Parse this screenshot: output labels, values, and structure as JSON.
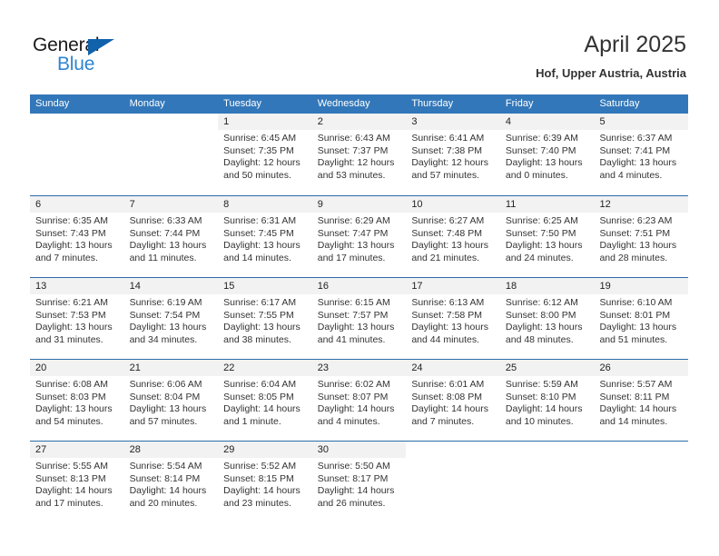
{
  "brand": {
    "name_part1": "General",
    "name_part2": "Blue",
    "triangle_color": "#1062ab",
    "blue_color": "#2e85d0"
  },
  "header": {
    "title": "April 2025",
    "location": "Hof, Upper Austria, Austria"
  },
  "theme": {
    "header_blue": "#3277b9",
    "day_band_gray": "#f2f2f2",
    "text_color": "#333333"
  },
  "weekdays": [
    "Sunday",
    "Monday",
    "Tuesday",
    "Wednesday",
    "Thursday",
    "Friday",
    "Saturday"
  ],
  "weeks": [
    [
      {
        "day": "",
        "sunrise": "",
        "sunset": "",
        "daylight1": "",
        "daylight2": ""
      },
      {
        "day": "",
        "sunrise": "",
        "sunset": "",
        "daylight1": "",
        "daylight2": ""
      },
      {
        "day": "1",
        "sunrise": "Sunrise: 6:45 AM",
        "sunset": "Sunset: 7:35 PM",
        "daylight1": "Daylight: 12 hours",
        "daylight2": "and 50 minutes."
      },
      {
        "day": "2",
        "sunrise": "Sunrise: 6:43 AM",
        "sunset": "Sunset: 7:37 PM",
        "daylight1": "Daylight: 12 hours",
        "daylight2": "and 53 minutes."
      },
      {
        "day": "3",
        "sunrise": "Sunrise: 6:41 AM",
        "sunset": "Sunset: 7:38 PM",
        "daylight1": "Daylight: 12 hours",
        "daylight2": "and 57 minutes."
      },
      {
        "day": "4",
        "sunrise": "Sunrise: 6:39 AM",
        "sunset": "Sunset: 7:40 PM",
        "daylight1": "Daylight: 13 hours",
        "daylight2": "and 0 minutes."
      },
      {
        "day": "5",
        "sunrise": "Sunrise: 6:37 AM",
        "sunset": "Sunset: 7:41 PM",
        "daylight1": "Daylight: 13 hours",
        "daylight2": "and 4 minutes."
      }
    ],
    [
      {
        "day": "6",
        "sunrise": "Sunrise: 6:35 AM",
        "sunset": "Sunset: 7:43 PM",
        "daylight1": "Daylight: 13 hours",
        "daylight2": "and 7 minutes."
      },
      {
        "day": "7",
        "sunrise": "Sunrise: 6:33 AM",
        "sunset": "Sunset: 7:44 PM",
        "daylight1": "Daylight: 13 hours",
        "daylight2": "and 11 minutes."
      },
      {
        "day": "8",
        "sunrise": "Sunrise: 6:31 AM",
        "sunset": "Sunset: 7:45 PM",
        "daylight1": "Daylight: 13 hours",
        "daylight2": "and 14 minutes."
      },
      {
        "day": "9",
        "sunrise": "Sunrise: 6:29 AM",
        "sunset": "Sunset: 7:47 PM",
        "daylight1": "Daylight: 13 hours",
        "daylight2": "and 17 minutes."
      },
      {
        "day": "10",
        "sunrise": "Sunrise: 6:27 AM",
        "sunset": "Sunset: 7:48 PM",
        "daylight1": "Daylight: 13 hours",
        "daylight2": "and 21 minutes."
      },
      {
        "day": "11",
        "sunrise": "Sunrise: 6:25 AM",
        "sunset": "Sunset: 7:50 PM",
        "daylight1": "Daylight: 13 hours",
        "daylight2": "and 24 minutes."
      },
      {
        "day": "12",
        "sunrise": "Sunrise: 6:23 AM",
        "sunset": "Sunset: 7:51 PM",
        "daylight1": "Daylight: 13 hours",
        "daylight2": "and 28 minutes."
      }
    ],
    [
      {
        "day": "13",
        "sunrise": "Sunrise: 6:21 AM",
        "sunset": "Sunset: 7:53 PM",
        "daylight1": "Daylight: 13 hours",
        "daylight2": "and 31 minutes."
      },
      {
        "day": "14",
        "sunrise": "Sunrise: 6:19 AM",
        "sunset": "Sunset: 7:54 PM",
        "daylight1": "Daylight: 13 hours",
        "daylight2": "and 34 minutes."
      },
      {
        "day": "15",
        "sunrise": "Sunrise: 6:17 AM",
        "sunset": "Sunset: 7:55 PM",
        "daylight1": "Daylight: 13 hours",
        "daylight2": "and 38 minutes."
      },
      {
        "day": "16",
        "sunrise": "Sunrise: 6:15 AM",
        "sunset": "Sunset: 7:57 PM",
        "daylight1": "Daylight: 13 hours",
        "daylight2": "and 41 minutes."
      },
      {
        "day": "17",
        "sunrise": "Sunrise: 6:13 AM",
        "sunset": "Sunset: 7:58 PM",
        "daylight1": "Daylight: 13 hours",
        "daylight2": "and 44 minutes."
      },
      {
        "day": "18",
        "sunrise": "Sunrise: 6:12 AM",
        "sunset": "Sunset: 8:00 PM",
        "daylight1": "Daylight: 13 hours",
        "daylight2": "and 48 minutes."
      },
      {
        "day": "19",
        "sunrise": "Sunrise: 6:10 AM",
        "sunset": "Sunset: 8:01 PM",
        "daylight1": "Daylight: 13 hours",
        "daylight2": "and 51 minutes."
      }
    ],
    [
      {
        "day": "20",
        "sunrise": "Sunrise: 6:08 AM",
        "sunset": "Sunset: 8:03 PM",
        "daylight1": "Daylight: 13 hours",
        "daylight2": "and 54 minutes."
      },
      {
        "day": "21",
        "sunrise": "Sunrise: 6:06 AM",
        "sunset": "Sunset: 8:04 PM",
        "daylight1": "Daylight: 13 hours",
        "daylight2": "and 57 minutes."
      },
      {
        "day": "22",
        "sunrise": "Sunrise: 6:04 AM",
        "sunset": "Sunset: 8:05 PM",
        "daylight1": "Daylight: 14 hours",
        "daylight2": "and 1 minute."
      },
      {
        "day": "23",
        "sunrise": "Sunrise: 6:02 AM",
        "sunset": "Sunset: 8:07 PM",
        "daylight1": "Daylight: 14 hours",
        "daylight2": "and 4 minutes."
      },
      {
        "day": "24",
        "sunrise": "Sunrise: 6:01 AM",
        "sunset": "Sunset: 8:08 PM",
        "daylight1": "Daylight: 14 hours",
        "daylight2": "and 7 minutes."
      },
      {
        "day": "25",
        "sunrise": "Sunrise: 5:59 AM",
        "sunset": "Sunset: 8:10 PM",
        "daylight1": "Daylight: 14 hours",
        "daylight2": "and 10 minutes."
      },
      {
        "day": "26",
        "sunrise": "Sunrise: 5:57 AM",
        "sunset": "Sunset: 8:11 PM",
        "daylight1": "Daylight: 14 hours",
        "daylight2": "and 14 minutes."
      }
    ],
    [
      {
        "day": "27",
        "sunrise": "Sunrise: 5:55 AM",
        "sunset": "Sunset: 8:13 PM",
        "daylight1": "Daylight: 14 hours",
        "daylight2": "and 17 minutes."
      },
      {
        "day": "28",
        "sunrise": "Sunrise: 5:54 AM",
        "sunset": "Sunset: 8:14 PM",
        "daylight1": "Daylight: 14 hours",
        "daylight2": "and 20 minutes."
      },
      {
        "day": "29",
        "sunrise": "Sunrise: 5:52 AM",
        "sunset": "Sunset: 8:15 PM",
        "daylight1": "Daylight: 14 hours",
        "daylight2": "and 23 minutes."
      },
      {
        "day": "30",
        "sunrise": "Sunrise: 5:50 AM",
        "sunset": "Sunset: 8:17 PM",
        "daylight1": "Daylight: 14 hours",
        "daylight2": "and 26 minutes."
      },
      {
        "day": "",
        "sunrise": "",
        "sunset": "",
        "daylight1": "",
        "daylight2": ""
      },
      {
        "day": "",
        "sunrise": "",
        "sunset": "",
        "daylight1": "",
        "daylight2": ""
      },
      {
        "day": "",
        "sunrise": "",
        "sunset": "",
        "daylight1": "",
        "daylight2": ""
      }
    ]
  ]
}
